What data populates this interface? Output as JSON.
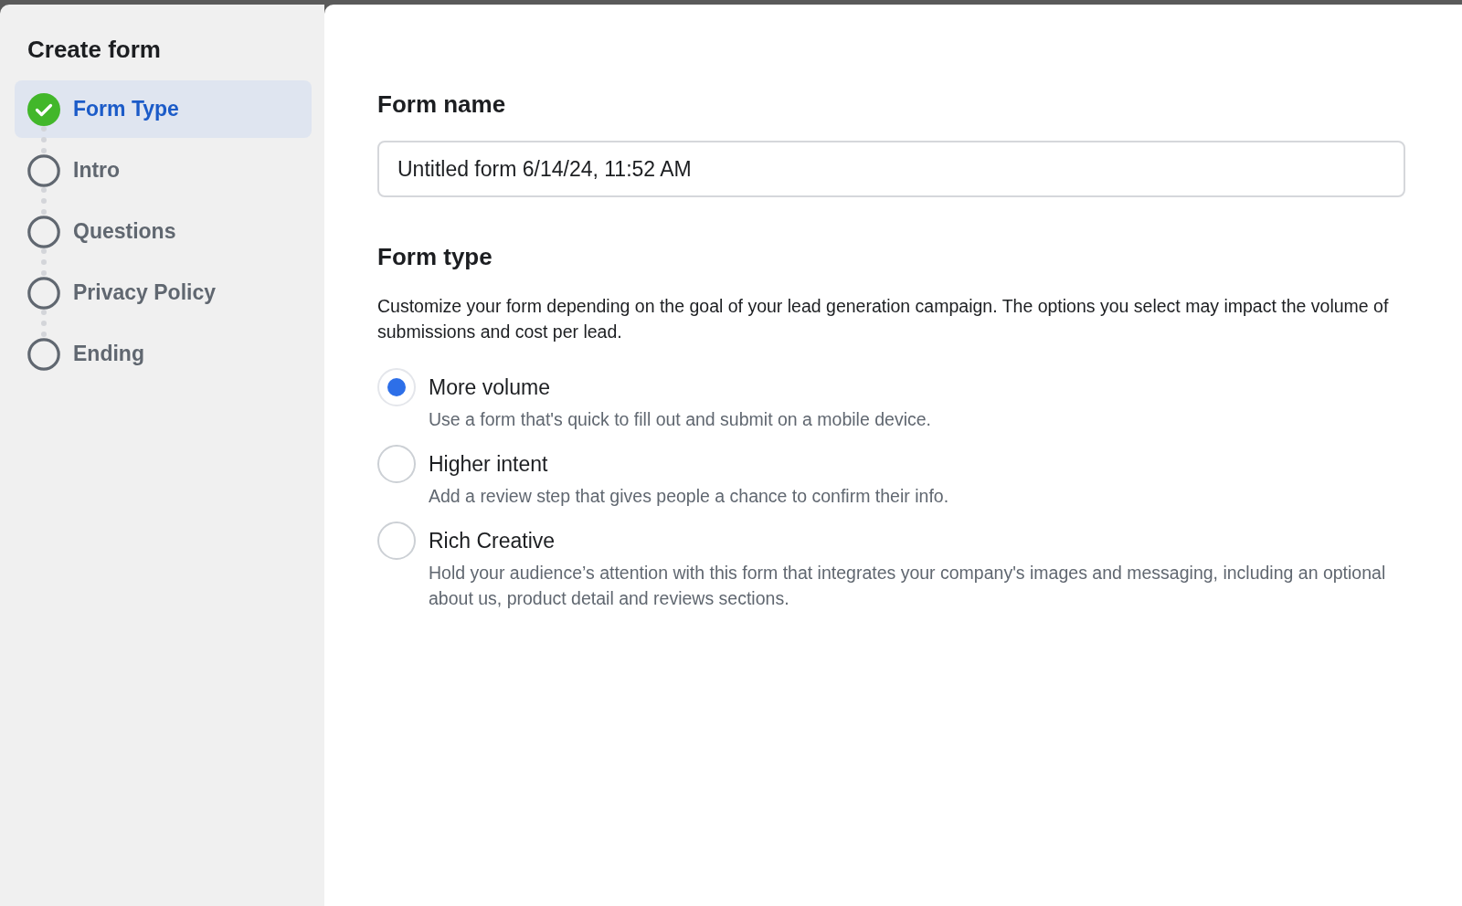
{
  "sidebar": {
    "title": "Create form",
    "steps": [
      {
        "label": "Form Type",
        "selected": true,
        "completed": true
      },
      {
        "label": "Intro",
        "selected": false,
        "completed": false
      },
      {
        "label": "Questions",
        "selected": false,
        "completed": false
      },
      {
        "label": "Privacy Policy",
        "selected": false,
        "completed": false
      },
      {
        "label": "Ending",
        "selected": false,
        "completed": false
      }
    ]
  },
  "form_name": {
    "heading": "Form name",
    "value": "Untitled form 6/14/24, 11:52 AM"
  },
  "form_type": {
    "heading": "Form type",
    "description": "Customize your form depending on the goal of your lead generation campaign. The options you select may impact the volume of submissions and cost per lead.",
    "options": [
      {
        "label": "More volume",
        "description": "Use a form that's quick to fill out and submit on a mobile device.",
        "selected": true
      },
      {
        "label": "Higher intent",
        "description": "Add a review step that gives people a chance to confirm their info.",
        "selected": false
      },
      {
        "label": "Rich Creative",
        "description": "Hold your audience’s attention with this form that integrates your company's images and messaging, including an optional about us, product detail and reviews sections.",
        "selected": false
      }
    ]
  }
}
